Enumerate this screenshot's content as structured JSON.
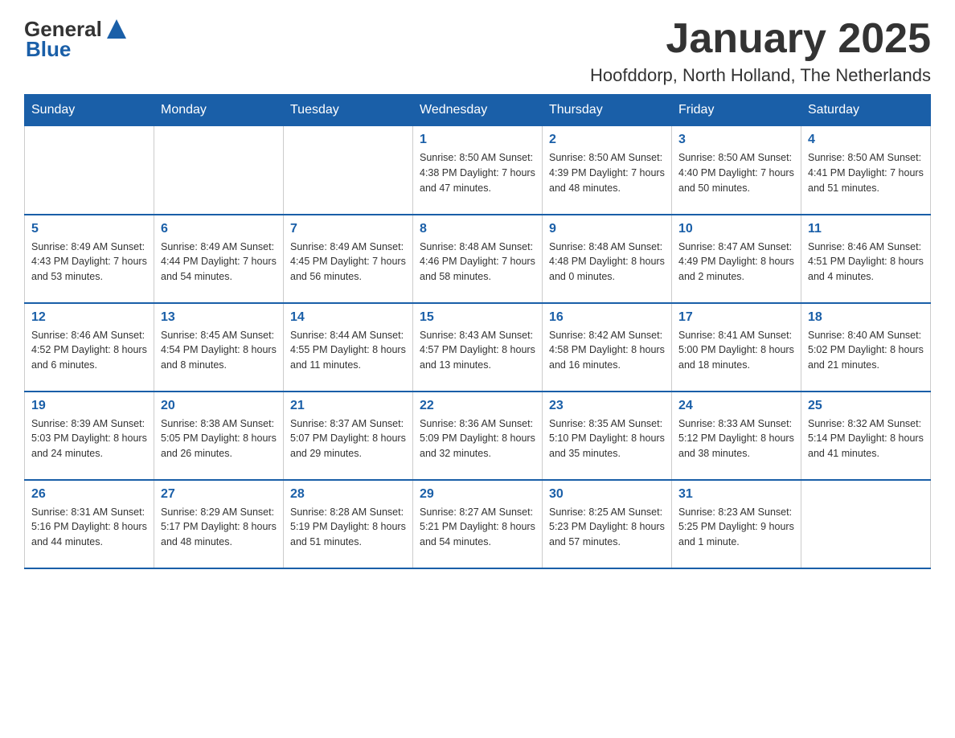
{
  "logo": {
    "general": "General",
    "blue": "Blue"
  },
  "title": {
    "month": "January 2025",
    "location": "Hoofddorp, North Holland, The Netherlands"
  },
  "days_of_week": [
    "Sunday",
    "Monday",
    "Tuesday",
    "Wednesday",
    "Thursday",
    "Friday",
    "Saturday"
  ],
  "weeks": [
    [
      {
        "day": "",
        "info": ""
      },
      {
        "day": "",
        "info": ""
      },
      {
        "day": "",
        "info": ""
      },
      {
        "day": "1",
        "info": "Sunrise: 8:50 AM\nSunset: 4:38 PM\nDaylight: 7 hours\nand 47 minutes."
      },
      {
        "day": "2",
        "info": "Sunrise: 8:50 AM\nSunset: 4:39 PM\nDaylight: 7 hours\nand 48 minutes."
      },
      {
        "day": "3",
        "info": "Sunrise: 8:50 AM\nSunset: 4:40 PM\nDaylight: 7 hours\nand 50 minutes."
      },
      {
        "day": "4",
        "info": "Sunrise: 8:50 AM\nSunset: 4:41 PM\nDaylight: 7 hours\nand 51 minutes."
      }
    ],
    [
      {
        "day": "5",
        "info": "Sunrise: 8:49 AM\nSunset: 4:43 PM\nDaylight: 7 hours\nand 53 minutes."
      },
      {
        "day": "6",
        "info": "Sunrise: 8:49 AM\nSunset: 4:44 PM\nDaylight: 7 hours\nand 54 minutes."
      },
      {
        "day": "7",
        "info": "Sunrise: 8:49 AM\nSunset: 4:45 PM\nDaylight: 7 hours\nand 56 minutes."
      },
      {
        "day": "8",
        "info": "Sunrise: 8:48 AM\nSunset: 4:46 PM\nDaylight: 7 hours\nand 58 minutes."
      },
      {
        "day": "9",
        "info": "Sunrise: 8:48 AM\nSunset: 4:48 PM\nDaylight: 8 hours\nand 0 minutes."
      },
      {
        "day": "10",
        "info": "Sunrise: 8:47 AM\nSunset: 4:49 PM\nDaylight: 8 hours\nand 2 minutes."
      },
      {
        "day": "11",
        "info": "Sunrise: 8:46 AM\nSunset: 4:51 PM\nDaylight: 8 hours\nand 4 minutes."
      }
    ],
    [
      {
        "day": "12",
        "info": "Sunrise: 8:46 AM\nSunset: 4:52 PM\nDaylight: 8 hours\nand 6 minutes."
      },
      {
        "day": "13",
        "info": "Sunrise: 8:45 AM\nSunset: 4:54 PM\nDaylight: 8 hours\nand 8 minutes."
      },
      {
        "day": "14",
        "info": "Sunrise: 8:44 AM\nSunset: 4:55 PM\nDaylight: 8 hours\nand 11 minutes."
      },
      {
        "day": "15",
        "info": "Sunrise: 8:43 AM\nSunset: 4:57 PM\nDaylight: 8 hours\nand 13 minutes."
      },
      {
        "day": "16",
        "info": "Sunrise: 8:42 AM\nSunset: 4:58 PM\nDaylight: 8 hours\nand 16 minutes."
      },
      {
        "day": "17",
        "info": "Sunrise: 8:41 AM\nSunset: 5:00 PM\nDaylight: 8 hours\nand 18 minutes."
      },
      {
        "day": "18",
        "info": "Sunrise: 8:40 AM\nSunset: 5:02 PM\nDaylight: 8 hours\nand 21 minutes."
      }
    ],
    [
      {
        "day": "19",
        "info": "Sunrise: 8:39 AM\nSunset: 5:03 PM\nDaylight: 8 hours\nand 24 minutes."
      },
      {
        "day": "20",
        "info": "Sunrise: 8:38 AM\nSunset: 5:05 PM\nDaylight: 8 hours\nand 26 minutes."
      },
      {
        "day": "21",
        "info": "Sunrise: 8:37 AM\nSunset: 5:07 PM\nDaylight: 8 hours\nand 29 minutes."
      },
      {
        "day": "22",
        "info": "Sunrise: 8:36 AM\nSunset: 5:09 PM\nDaylight: 8 hours\nand 32 minutes."
      },
      {
        "day": "23",
        "info": "Sunrise: 8:35 AM\nSunset: 5:10 PM\nDaylight: 8 hours\nand 35 minutes."
      },
      {
        "day": "24",
        "info": "Sunrise: 8:33 AM\nSunset: 5:12 PM\nDaylight: 8 hours\nand 38 minutes."
      },
      {
        "day": "25",
        "info": "Sunrise: 8:32 AM\nSunset: 5:14 PM\nDaylight: 8 hours\nand 41 minutes."
      }
    ],
    [
      {
        "day": "26",
        "info": "Sunrise: 8:31 AM\nSunset: 5:16 PM\nDaylight: 8 hours\nand 44 minutes."
      },
      {
        "day": "27",
        "info": "Sunrise: 8:29 AM\nSunset: 5:17 PM\nDaylight: 8 hours\nand 48 minutes."
      },
      {
        "day": "28",
        "info": "Sunrise: 8:28 AM\nSunset: 5:19 PM\nDaylight: 8 hours\nand 51 minutes."
      },
      {
        "day": "29",
        "info": "Sunrise: 8:27 AM\nSunset: 5:21 PM\nDaylight: 8 hours\nand 54 minutes."
      },
      {
        "day": "30",
        "info": "Sunrise: 8:25 AM\nSunset: 5:23 PM\nDaylight: 8 hours\nand 57 minutes."
      },
      {
        "day": "31",
        "info": "Sunrise: 8:23 AM\nSunset: 5:25 PM\nDaylight: 9 hours\nand 1 minute."
      },
      {
        "day": "",
        "info": ""
      }
    ]
  ]
}
